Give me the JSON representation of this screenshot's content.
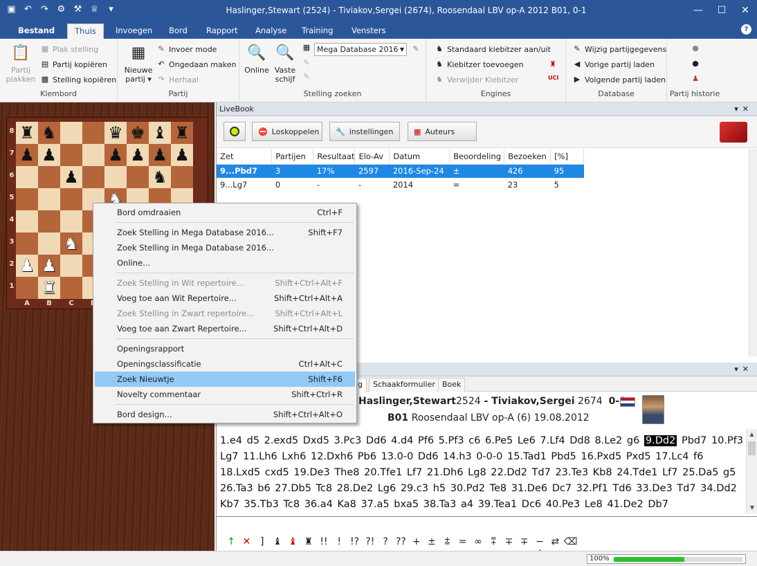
{
  "window": {
    "title": "Haslinger,Stewart (2524) - Tiviakov,Sergei (2674), Roosendaal LBV op-A 2012  B01, 0-1"
  },
  "menu": {
    "file": "Bestand",
    "tabs": [
      "Thuis",
      "Invoegen",
      "Bord",
      "Rapport",
      "Analyse",
      "Training",
      "Vensters"
    ],
    "help": "?"
  },
  "ribbon": {
    "klembord": {
      "label": "Klembord",
      "paste": "Partij\nplakken",
      "plak": "Plak stelling",
      "kopieren": "Partij kopiëren",
      "stelling": "Stelling kopiëren"
    },
    "partij": {
      "label": "Partij",
      "nieuwe": "Nieuwe\npartij ▾",
      "invoer": "Invoer mode",
      "ongedaan": "Ongedaan maken",
      "herhaal": "Herhaal"
    },
    "zoeken": {
      "label": "Stelling zoeken",
      "online": "Online",
      "vaste": "Vaste\nschijf",
      "db": "Mega Database 2016"
    },
    "engines": {
      "label": "Engines",
      "std": "Standaard kiebitzer aan/uit",
      "add": "Kiebitzer toevoegen",
      "rem": "Verwijder Kiebitzer"
    },
    "database": {
      "label": "Database",
      "wijzig": "Wijzig partijgegevens",
      "vorige": "Vorige partij laden",
      "volgende": "Volgende partij laden"
    },
    "historie": {
      "label": "Partij historie"
    }
  },
  "board": {
    "ranks": [
      "8",
      "7",
      "6",
      "5",
      "4",
      "3",
      "2",
      "1"
    ],
    "files": [
      "A",
      "B",
      "C",
      "D",
      "E",
      "F",
      "G",
      "H"
    ],
    "rows": [
      [
        "r",
        "n",
        "",
        "",
        "q",
        "k",
        "b",
        "r"
      ],
      [
        "p",
        "p",
        "",
        "",
        "p",
        "p",
        "p",
        "p"
      ],
      [
        "",
        "",
        "p",
        "",
        "",
        "",
        "n",
        ""
      ],
      [
        "",
        "",
        "",
        "",
        "N",
        "",
        "",
        ""
      ],
      [
        "",
        "",
        "",
        "",
        "P",
        "",
        "",
        ""
      ],
      [
        "",
        "",
        "N",
        "",
        "",
        "",
        "",
        ""
      ],
      [
        "P",
        "P",
        "",
        "",
        "",
        "",
        "",
        ""
      ],
      [
        "",
        "R",
        "",
        "",
        "",
        "",
        "",
        ""
      ]
    ]
  },
  "livebook": {
    "title": "LiveBook",
    "buttons": [
      "Loskoppelen",
      "instellingen",
      "Auteurs"
    ],
    "columns": [
      "Zet",
      "Partijen",
      "Resultaat",
      "Elo-Av",
      "Datum",
      "Beoordeling",
      "Bezoeken",
      "[%]"
    ],
    "rows": [
      [
        "9...Pbd7",
        "3",
        "17%",
        "2597",
        "2016-Sep-24",
        "±",
        "426",
        "95"
      ],
      [
        "9...Lg7",
        "0",
        "-",
        "-",
        "2014",
        "=",
        "23",
        "5"
      ]
    ]
  },
  "notation": {
    "tabs": [
      "ng",
      "Schaakformulier",
      "Boek"
    ],
    "white": "Haslinger,Stewart",
    "welo": "2524",
    "sep": " - ",
    "black": "Tiviakov,Sergei",
    "belo": "2674",
    "result": "0-1",
    "eco": "B01",
    "event": "Roosendaal LBV op-A (6) 19.08.2012",
    "moves_before": "1.e4 d5 2.exd5 Dxd5 3.Pc3 Dd6 4.d4 Pf6 5.Pf3 c6 6.Pe5 Le6 7.Lf4 Dd8 8.Le2 g6 ",
    "current": "9.Dd2",
    "moves_after": " Pbd7 10.Pf3 Lg7 11.Lh6 Lxh6 12.Dxh6 Pb6 13.0-0 Dd6 14.h3 0-0-0 15.Tad1 Pbd5 16.Pxd5 Pxd5 17.Lc4 f6 18.Lxd5 cxd5 19.De3 The8 20.Tfe1 Lf7 21.Dh6 Lg8 22.Dd2 Td7 23.Te3 Kb8 24.Tde1 Lf7 25.Da5 g5 26.Ta3 b6 27.Db5 Tc8 28.De2 Lg6 29.c3 h5 30.Pd2 Te8 31.De6 Dc7 32.Pf1 Td6 33.De3 Td7 34.Dd2 Kb7 35.Tb3 Tc8 36.a4 Ka8 37.a5 bxa5 38.Ta3 a4 39.Tea1 Dc6 40.Pe3 Le8 41.De2 Db7",
    "symbols": [
      "↑",
      "✕",
      "]",
      "♝",
      "♝",
      "♜",
      "!!",
      "!",
      "!?",
      "?!",
      "?",
      "??",
      "+−",
      "±",
      "⩲",
      "=",
      "∞",
      "⩱",
      "∓",
      "∓",
      "−+",
      "⇄",
      "⌫"
    ]
  },
  "status": {
    "zoom": "100%",
    "progress": 0.55
  },
  "context_menu": [
    {
      "label": "Bord omdraaien",
      "shortcut": "Ctrl+F",
      "state": "normal"
    },
    {
      "sep": true
    },
    {
      "label": "Zoek Stelling in Mega Database 2016...",
      "shortcut": "Shift+F7",
      "state": "normal"
    },
    {
      "label": "Zoek Stelling in Mega Database 2016...",
      "shortcut": "",
      "state": "normal"
    },
    {
      "label": "Online...",
      "shortcut": "",
      "state": "normal"
    },
    {
      "sep": true
    },
    {
      "label": "Zoek Stelling in Wit repertoire...",
      "shortcut": "Shift+Ctrl+Alt+F",
      "state": "disabled"
    },
    {
      "label": "Voeg toe aan Wit Repertoire...",
      "shortcut": "Shift+Ctrl+Alt+A",
      "state": "normal"
    },
    {
      "label": "Zoek Stelling in Zwart repertoire...",
      "shortcut": "Shift+Ctrl+Alt+L",
      "state": "disabled"
    },
    {
      "label": "Voeg toe aan Zwart Repertoire...",
      "shortcut": "Shift+Ctrl+Alt+D",
      "state": "normal"
    },
    {
      "sep": true
    },
    {
      "label": "Openingsrapport",
      "shortcut": "",
      "state": "normal"
    },
    {
      "label": "Openingsclassificatie",
      "shortcut": "Ctrl+Alt+C",
      "state": "normal"
    },
    {
      "label": "Zoek Nieuwtje",
      "shortcut": "Shift+F6",
      "state": "highlighted"
    },
    {
      "label": "Novelty commentaar",
      "shortcut": "Shift+Ctrl+R",
      "state": "normal"
    },
    {
      "sep": true
    },
    {
      "label": "Bord design...",
      "shortcut": "Shift+Ctrl+Alt+O",
      "state": "normal"
    }
  ]
}
